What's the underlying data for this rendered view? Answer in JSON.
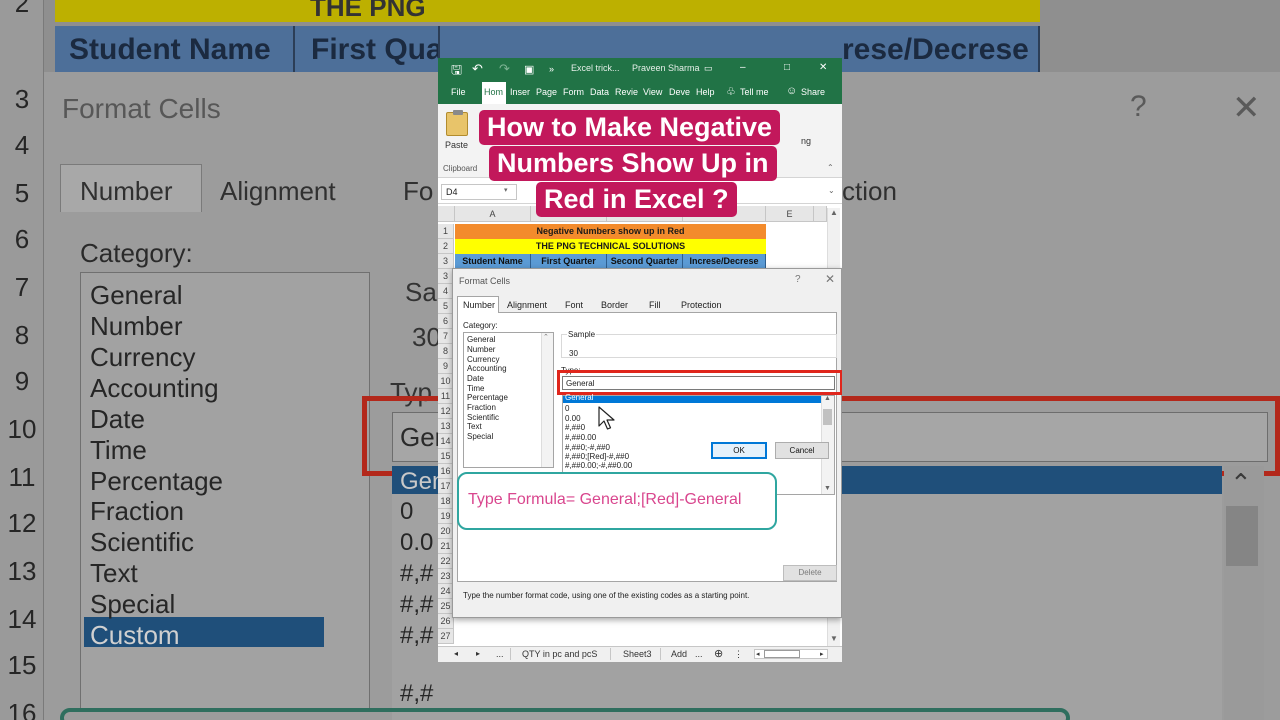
{
  "background": {
    "row_numbers": [
      "2",
      "3",
      "4",
      "5",
      "6",
      "7",
      "8",
      "9",
      "10",
      "11",
      "12",
      "13",
      "14",
      "15",
      "16"
    ],
    "yellow_text": "THE PNG",
    "blue_cells": [
      "Student Name",
      "First Qua",
      "rese/Decrese"
    ],
    "dialog_title": "Format Cells",
    "help": "?",
    "close": "✕",
    "tabs": [
      "Number",
      "Alignment",
      "Fo",
      "ction"
    ],
    "category_label": "Category:",
    "categories": [
      "General",
      "Number",
      "Currency",
      "Accounting",
      "Date",
      "Time",
      "Percentage",
      "Fraction",
      "Scientific",
      "Text",
      "Special",
      "Custom"
    ],
    "sample_label": "Sa",
    "sample_value": "30",
    "type_label": "Typ",
    "type_value": "Gen",
    "formats": [
      "Gen",
      "0",
      "0.0",
      "#,#",
      "#,#",
      "#,#",
      "#,#"
    ]
  },
  "excel": {
    "title_file": "Excel trick...",
    "title_user": "Praveen Sharma",
    "tabs": [
      "File",
      "Hom",
      "Inser",
      "Page",
      "Form",
      "Data",
      "Revie",
      "View",
      "Deve",
      "Help"
    ],
    "tell_me": "Tell me",
    "share": "Share",
    "paste": "Paste",
    "clipboard": "Clipboard",
    "ribbon_fragment": "ng",
    "name_box": "D4",
    "columns": [
      "A",
      "E"
    ],
    "rows": [
      "1",
      "2",
      "3",
      "4",
      "5",
      "6",
      "7",
      "8",
      "9",
      "10",
      "11",
      "12",
      "13",
      "14",
      "15",
      "16",
      "17",
      "18",
      "19",
      "20",
      "21",
      "22",
      "23",
      "24",
      "25",
      "26",
      "27"
    ],
    "row1": "Negative Numbers show up in Red",
    "row2": "THE PNG TECHNICAL SOLUTIONS",
    "headers": [
      "Student Name",
      "First Quarter",
      "Second Quarter",
      "Increse/Decrese"
    ],
    "sheet_tabs": [
      "...",
      "QTY in pc and pcS",
      "Sheet3",
      "Add",
      "..."
    ]
  },
  "dialog": {
    "title": "Format Cells",
    "help": "?",
    "close": "✕",
    "tabs": [
      "Number",
      "Alignment",
      "Font",
      "Border",
      "Fill",
      "Protection"
    ],
    "category_label": "Category:",
    "categories": [
      "General",
      "Number",
      "Currency",
      "Accounting",
      "Date",
      "Time",
      "Percentage",
      "Fraction",
      "Scientific",
      "Text",
      "Special",
      "Custom"
    ],
    "selected_category": "Custom",
    "sample_label": "Sample",
    "sample_value": "30",
    "type_label": "Type:",
    "type_value": "General",
    "formats": [
      "General",
      "0",
      "0.00",
      "#,##0",
      "#,##0.00",
      "#,##0;-#,##0",
      "#,##0;[Red]-#,##0",
      "#,##0.00;-#,##0.00"
    ],
    "delete": "Delete",
    "hint": "Type the number format code, using one of the existing codes as a starting point.",
    "ok": "OK",
    "cancel": "Cancel"
  },
  "overlay": {
    "headline_lines": [
      "How to Make Negative",
      "Numbers Show Up in",
      "Red in Excel ?"
    ],
    "callout": "Type Formula= General;[Red]-General"
  },
  "colors": {
    "excel_green": "#217346",
    "headline_bg": "#c2185b",
    "highlight_red": "#e0261c",
    "callout_border": "#2fa6a0",
    "callout_text": "#d9468e"
  }
}
